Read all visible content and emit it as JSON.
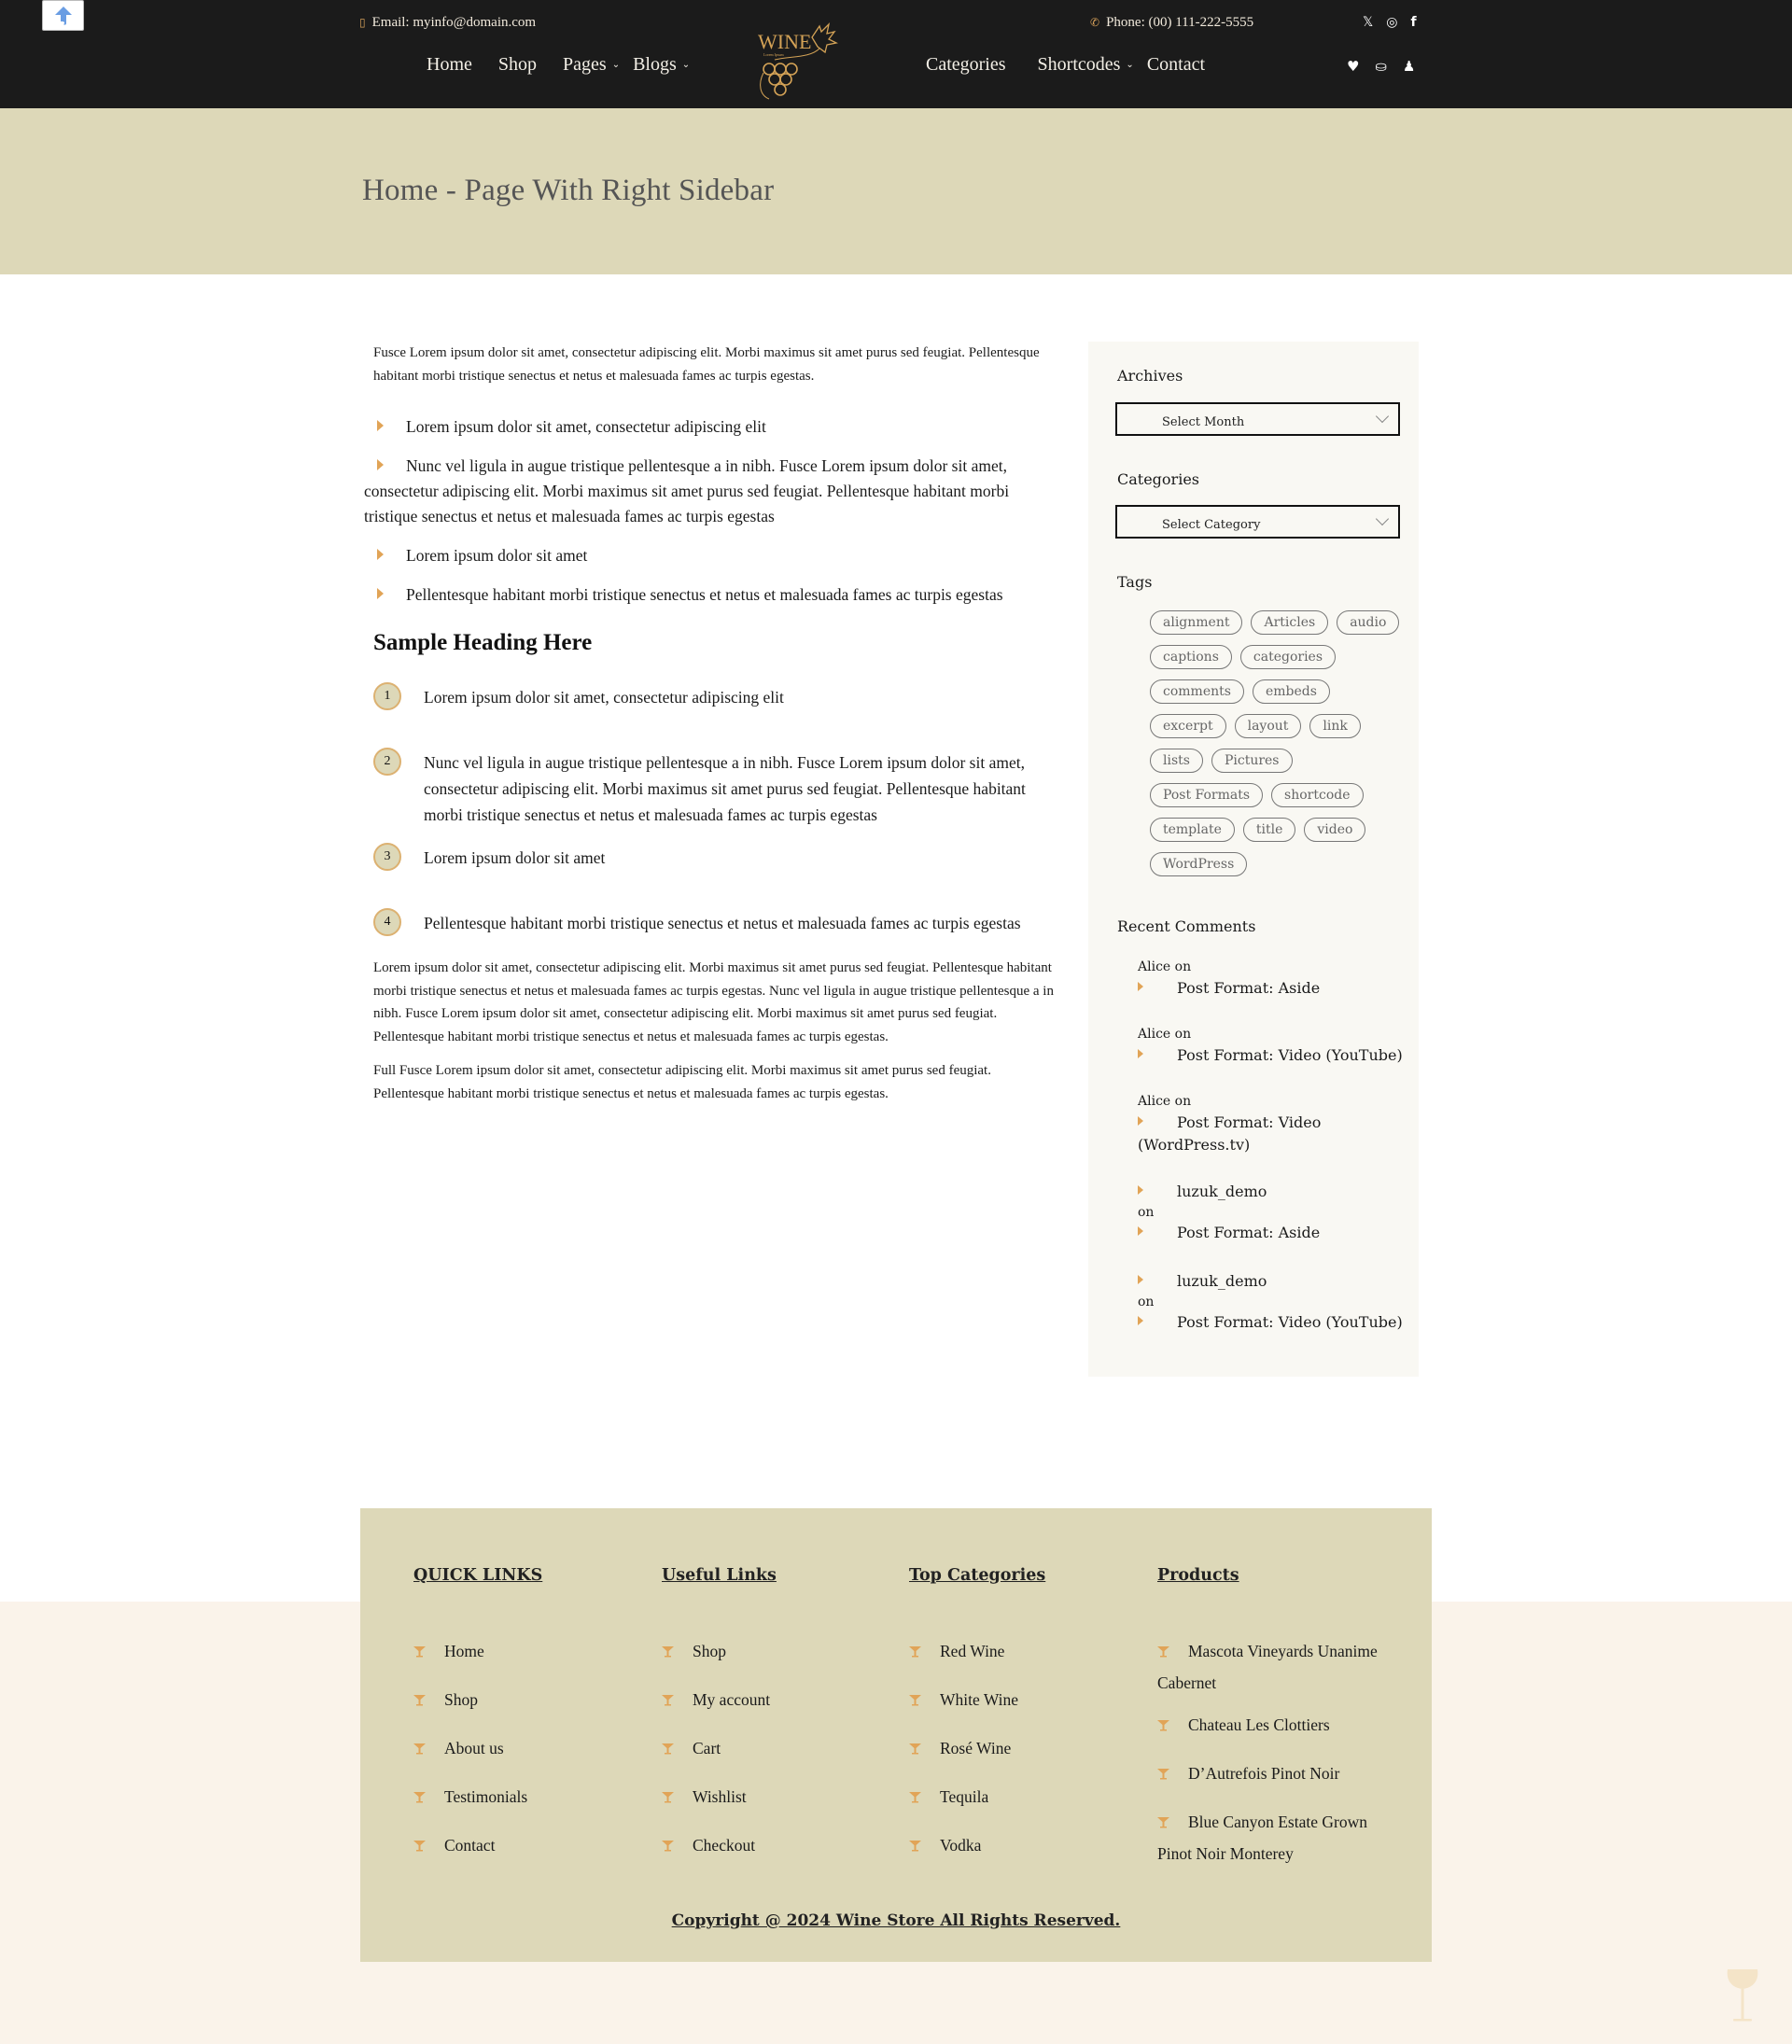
{
  "header": {
    "email": "Email: myinfo@domain.com",
    "phone": "Phone: (00) 111-222-5555",
    "nav_left": [
      {
        "label": "Home",
        "has_dropdown": false
      },
      {
        "label": "Shop",
        "has_dropdown": false
      },
      {
        "label": "Pages",
        "has_dropdown": true
      },
      {
        "label": "Blogs",
        "has_dropdown": true
      }
    ],
    "nav_right": [
      {
        "label": "Categories",
        "has_dropdown": false
      },
      {
        "label": "Shortcodes",
        "has_dropdown": true
      },
      {
        "label": "Contact",
        "has_dropdown": false
      }
    ],
    "logo": {
      "text": "WINE",
      "tagline": "Lorem Ipsum"
    },
    "social_icons": [
      "x-icon",
      "instagram-icon",
      "facebook-icon"
    ],
    "action_icons": [
      "heart-icon",
      "basket-icon",
      "user-icon"
    ]
  },
  "hero": {
    "title": "Home - Page With Right Sidebar"
  },
  "content": {
    "intro": "Fusce Lorem ipsum dolor sit amet, consectetur adipiscing elit. Morbi maximus sit amet purus sed feugiat. Pellentesque habitant morbi tristique senectus et netus et malesuada fames ac turpis egestas.",
    "bullets": [
      "Lorem ipsum dolor sit amet, consectetur adipiscing elit",
      "Nunc vel ligula in augue tristique pellentesque a in nibh. Fusce Lorem ipsum dolor sit amet, consectetur adipiscing elit. Morbi maximus sit amet purus sed feugiat. Pellentesque habitant morbi tristique senectus et netus et malesuada fames ac turpis egestas",
      "Lorem ipsum dolor sit amet",
      "Pellentesque habitant morbi tristique senectus et netus et malesuada fames ac turpis egestas"
    ],
    "heading": "Sample Heading Here",
    "numbered": [
      {
        "num": "1",
        "text": "Lorem ipsum dolor sit amet, consectetur adipiscing elit"
      },
      {
        "num": "2",
        "text": "Nunc vel ligula in augue tristique pellentesque a in nibh. Fusce Lorem ipsum dolor sit amet, consectetur adipiscing elit. Morbi maximus sit amet purus sed feugiat. Pellentesque habitant morbi tristique senectus et netus et malesuada fames ac turpis egestas"
      },
      {
        "num": "3",
        "text": "Lorem ipsum dolor sit amet"
      },
      {
        "num": "4",
        "text": "Pellentesque habitant morbi tristique senectus et netus et malesuada fames ac turpis egestas"
      }
    ],
    "paragraph1": "Lorem ipsum dolor sit amet, consectetur adipiscing elit. Morbi maximus sit amet purus sed feugiat. Pellentesque habitant morbi tristique senectus et netus et malesuada fames ac turpis egestas. Nunc vel ligula in augue tristique pellentesque a in nibh. Fusce Lorem ipsum dolor sit amet, consectetur adipiscing elit. Morbi maximus sit amet purus sed feugiat. Pellentesque habitant morbi tristique senectus et netus et malesuada fames ac turpis egestas.",
    "paragraph2": "Full Fusce Lorem ipsum dolor sit amet, consectetur adipiscing elit. Morbi maximus sit amet purus sed feugiat. Pellentesque habitant morbi tristique senectus et netus et malesuada fames ac turpis egestas."
  },
  "sidebar": {
    "archives": {
      "title": "Archives",
      "select_value": "Select Month"
    },
    "categories": {
      "title": "Categories",
      "select_value": "Select Category"
    },
    "tags": {
      "title": "Tags",
      "items": [
        "alignment",
        "Articles",
        "audio",
        "captions",
        "categories",
        "comments",
        "embeds",
        "excerpt",
        "layout",
        "link",
        "lists",
        "Pictures",
        "Post Formats",
        "shortcode",
        "template",
        "title",
        "video",
        "WordPress"
      ]
    },
    "recent_comments": {
      "title": "Recent Comments",
      "on_label": "on",
      "items": [
        {
          "author": "Alice",
          "author_linked": false,
          "post": "Post Format: Aside"
        },
        {
          "author": "Alice",
          "author_linked": false,
          "post": "Post Format: Video (YouTube)"
        },
        {
          "author": "Alice",
          "author_linked": false,
          "post": "Post Format: Video (WordPress.tv)"
        },
        {
          "author": "luzuk_demo",
          "author_linked": true,
          "post": "Post Format: Aside"
        },
        {
          "author": "luzuk_demo",
          "author_linked": true,
          "post": "Post Format: Video (YouTube)"
        }
      ]
    }
  },
  "footer": {
    "columns": [
      {
        "title": "QUICK LINKS",
        "links": [
          "Home",
          "Shop",
          "About us",
          "Testimonials",
          "Contact"
        ]
      },
      {
        "title": "Useful Links",
        "links": [
          "Shop",
          "My account",
          "Cart",
          "Wishlist",
          "Checkout"
        ]
      },
      {
        "title": "Top Categories",
        "links": [
          "Red Wine",
          "White Wine",
          "Rosé Wine",
          "Tequila",
          "Vodka"
        ]
      },
      {
        "title": "Products",
        "links": [
          "Mascota Vineyards Unanime Cabernet",
          "Chateau Les Clottiers",
          "D’Autrefois Pinot Noir",
          "Blue Canyon Estate Grown Pinot Noir Monterey"
        ]
      }
    ],
    "copyright": "Copyright @ 2024 Wine Store All Rights Reserved."
  },
  "colors": {
    "header_bg": "#1b1b1b",
    "hero_bg": "#ddd8b8",
    "accent": "#e1a457",
    "sidebar_bg": "#f9f8f3",
    "footer_outer_bg": "#faf3ea"
  }
}
